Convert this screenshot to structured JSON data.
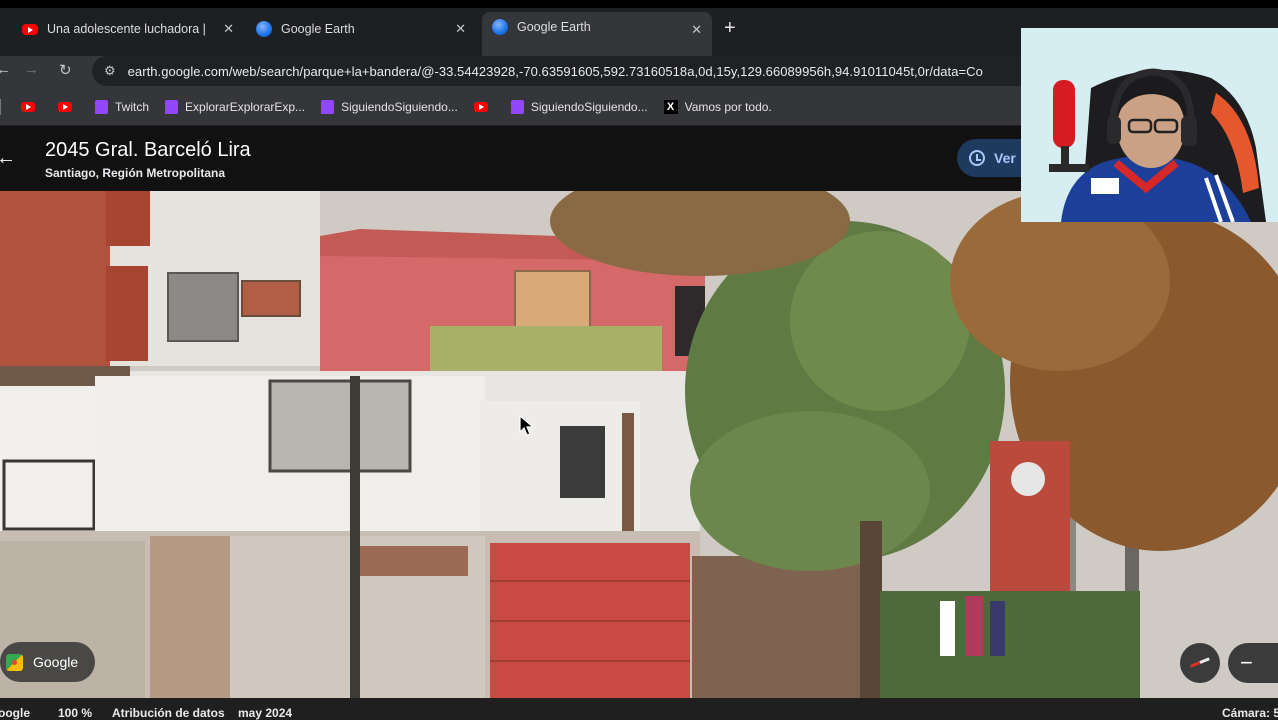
{
  "browser": {
    "tabs": [
      {
        "title": "Una adolescente luchadora | M",
        "icon": "youtube-icon",
        "active": false
      },
      {
        "title": "Google Earth",
        "icon": "google-earth-icon",
        "active": false
      },
      {
        "title": "Google Earth",
        "icon": "google-earth-icon",
        "active": true
      }
    ],
    "close_glyph": "✕",
    "new_tab_glyph": "+",
    "url": "earth.google.com/web/search/parque+la+bandera/@-33.54423928,-70.63591605,592.73160518a,0d,15y,129.66089956h,94.91011045t,0r/data=Co",
    "bookmarks": [
      {
        "label": "",
        "icon": "youtube-icon"
      },
      {
        "label": "",
        "icon": "youtube-icon"
      },
      {
        "label": "Twitch",
        "icon": "twitch-icon"
      },
      {
        "label": "ExplorarExplorarExp...",
        "icon": "twitch-icon"
      },
      {
        "label": "SiguiendoSiguiendo...",
        "icon": "twitch-icon"
      },
      {
        "label": "",
        "icon": "youtube-icon"
      },
      {
        "label": "SiguiendoSiguiendo...",
        "icon": "twitch-icon"
      },
      {
        "label": "Vamos por todo.",
        "icon": "x-icon"
      }
    ]
  },
  "earth": {
    "place_title": "2045 Gral. Barceló Lira",
    "place_subtitle": "Santiago, Región Metropolitana",
    "ver_button": "Ver",
    "google_pill": "Google",
    "status": {
      "brand": "oogle",
      "zoom": "100 %",
      "attribution": "Atribución de datos",
      "date": "may 2024",
      "camera": "Cámara: 5"
    },
    "zoom_out_glyph": "−"
  },
  "colors": {
    "chrome_dark": "#1e1f22",
    "chrome_mid": "#35363a",
    "accent_blue": "#a8c7fa",
    "youtube_red": "#ff0000",
    "twitch_purple": "#9146ff"
  }
}
